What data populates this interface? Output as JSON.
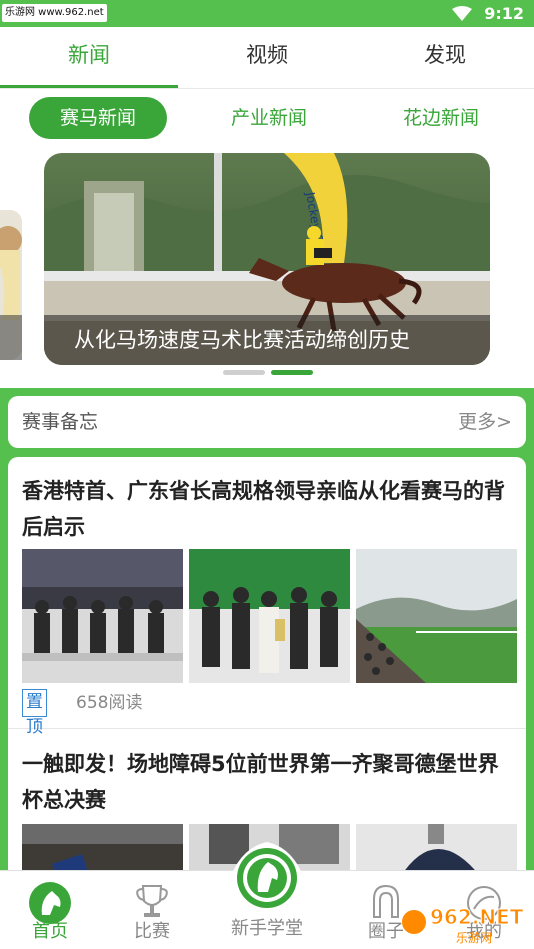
{
  "status_bar": {
    "watermark": "乐游网 www.962.net",
    "time": "9:12"
  },
  "top_tabs": [
    {
      "label": "新闻",
      "active": true
    },
    {
      "label": "视频",
      "active": false
    },
    {
      "label": "发现",
      "active": false
    }
  ],
  "sub_tabs": [
    {
      "label": "赛马新闻",
      "active": true
    },
    {
      "label": "产业新闻",
      "active": false
    },
    {
      "label": "花边新闻",
      "active": false
    }
  ],
  "carousel": {
    "caption": "从化马场速度马术比赛活动缔创历史",
    "slide_count": 2,
    "active_index": 1
  },
  "memo": {
    "title": "赛事备忘",
    "more": "更多>"
  },
  "news": [
    {
      "title": "香港特首、广东省长高规格领导亲临从化看赛马的背后启示",
      "badge": "置顶",
      "reads": "658阅读"
    },
    {
      "title": "一触即发！场地障碍5位前世界第一齐聚哥德堡世界杯总决赛"
    }
  ],
  "bottom_nav": [
    {
      "label": "首页",
      "icon": "horse-head-icon",
      "active": true
    },
    {
      "label": "比赛",
      "icon": "trophy-icon",
      "active": false
    },
    {
      "label": "新手学堂",
      "icon": "horse-emblem-icon",
      "active": false
    },
    {
      "label": "圈子",
      "icon": "horseshoe-icon",
      "active": false
    },
    {
      "label": "我的",
      "icon": "profile-icon",
      "active": false
    }
  ],
  "overlay_logo": {
    "text": "962.NET",
    "subtext": "乐游网"
  },
  "colors": {
    "brand_green": "#55c04d",
    "accent_green": "#3aa63a",
    "badge_blue": "#2a7ccc"
  }
}
